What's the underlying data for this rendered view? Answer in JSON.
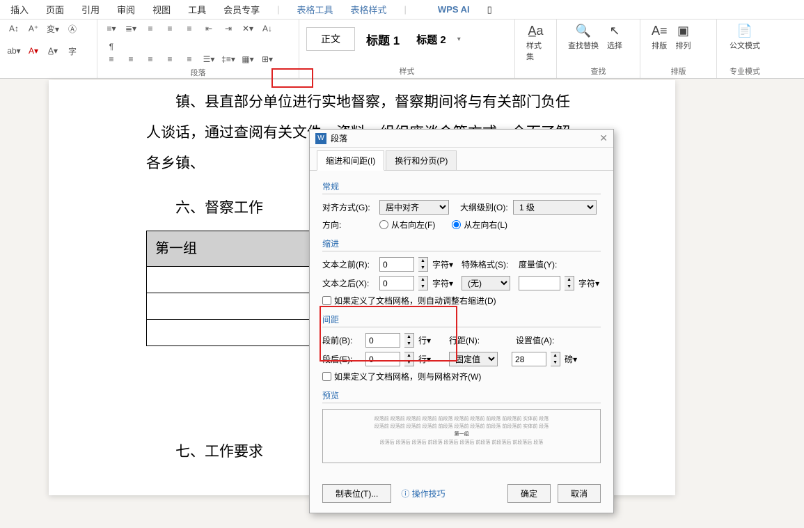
{
  "menubar": {
    "items": [
      "插入",
      "页面",
      "引用",
      "审阅",
      "视图",
      "工具",
      "会员专享"
    ],
    "tabletools": "表格工具",
    "tablestyle": "表格样式",
    "ai": "WPS AI",
    "ai_icon": "▯"
  },
  "ribbon": {
    "paragraph_label": "段落",
    "style_label": "样式",
    "find_label": "查找",
    "layout_label": "排版",
    "pro_label": "专业模式",
    "styles": {
      "normal": "正文",
      "h1": "标题 1",
      "h2": "标题 2"
    },
    "styleset": "样式集",
    "findreplace": "查找替换",
    "select": "选择",
    "arrange": "排版",
    "arrangecol": "排列",
    "docmode": "公文模式"
  },
  "doc": {
    "p1": "镇、县直部分单位进行实地督察，督察期间将与有关部门负任人谈话，通过查阅有关文件、资料，组织座谈会等方式，全面了解各乡镇、",
    "h6": "六、督察工作",
    "table_cell": "第一组",
    "h7": "七、工作要求"
  },
  "dialog": {
    "title": "段落",
    "tab1": "缩进和间距(I)",
    "tab2": "换行和分页(P)",
    "group_general": "常规",
    "align_label": "对齐方式(G):",
    "align_value": "居中对齐",
    "outline_label": "大纲级别(O):",
    "outline_value": "1 级",
    "direction_label": "方向:",
    "dir_rtl": "从右向左(F)",
    "dir_ltr": "从左向右(L)",
    "group_indent": "缩进",
    "before_text": "文本之前(R):",
    "after_text": "文本之后(X):",
    "char_unit": "字符",
    "special_label": "特殊格式(S):",
    "special_value": "(无)",
    "metric_label": "度量值(Y):",
    "indent_check": "如果定义了文档网格，则自动调整右缩进(D)",
    "group_spacing": "间距",
    "space_before": "段前(B):",
    "space_after": "段后(E):",
    "line_unit": "行",
    "linespace_label": "行距(N):",
    "linespace_value": "固定值",
    "setvalue_label": "设置值(A):",
    "setvalue": "28",
    "pt_unit": "磅",
    "spacing_check": "如果定义了文档网格，则与网格对齐(W)",
    "group_preview": "预览",
    "zero": "0",
    "tabstops": "制表位(T)...",
    "tips": "操作技巧",
    "ok": "确定",
    "cancel": "取消",
    "preview_line": "段落前 段落前 段落前 段落前 前段落 段落前 段落前 前段落 前段落前 实体前 段落",
    "preview_center": "第一组",
    "preview_after": "段落后 段落后 段落后 前段落 段落后 段落后 前段落 前段落后 前段落后 段落"
  }
}
